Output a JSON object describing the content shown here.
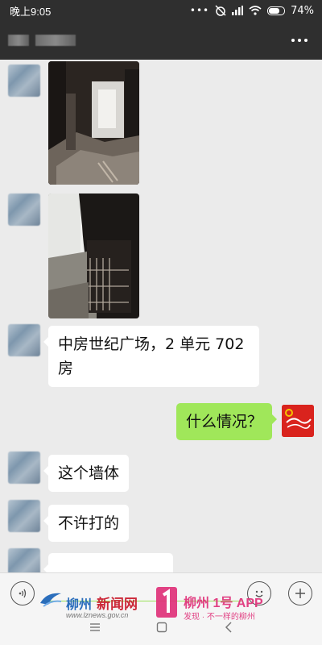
{
  "status_bar": {
    "time": "晚上9:05",
    "battery": "74%",
    "battery_level": 0.74
  },
  "chat": {
    "messages": [
      {
        "side": "left",
        "type": "image"
      },
      {
        "side": "left",
        "type": "image"
      },
      {
        "side": "left",
        "type": "text",
        "lines": [
          "中房世纪广场，2 单元 702",
          "房"
        ]
      },
      {
        "side": "right",
        "type": "text",
        "text": "什么情况？"
      },
      {
        "side": "left",
        "type": "text",
        "text": "这个墙体"
      },
      {
        "side": "left",
        "type": "text",
        "text": "不许打的"
      }
    ]
  },
  "watermark": {
    "site_name": "柳州",
    "site_name_art": "新闻网",
    "site_url": "www.lznews.gov.cn",
    "app_name": "柳州 1号 APP",
    "app_slogan": "发现 · 不一样的柳州"
  },
  "colors": {
    "header_bg": "#2f2f2f",
    "chat_bg": "#ebebeb",
    "my_bubble": "#a0e75a",
    "their_bubble": "#ffffff",
    "watermark_blue": "#1a63b8",
    "watermark_pink": "#e0327a"
  }
}
